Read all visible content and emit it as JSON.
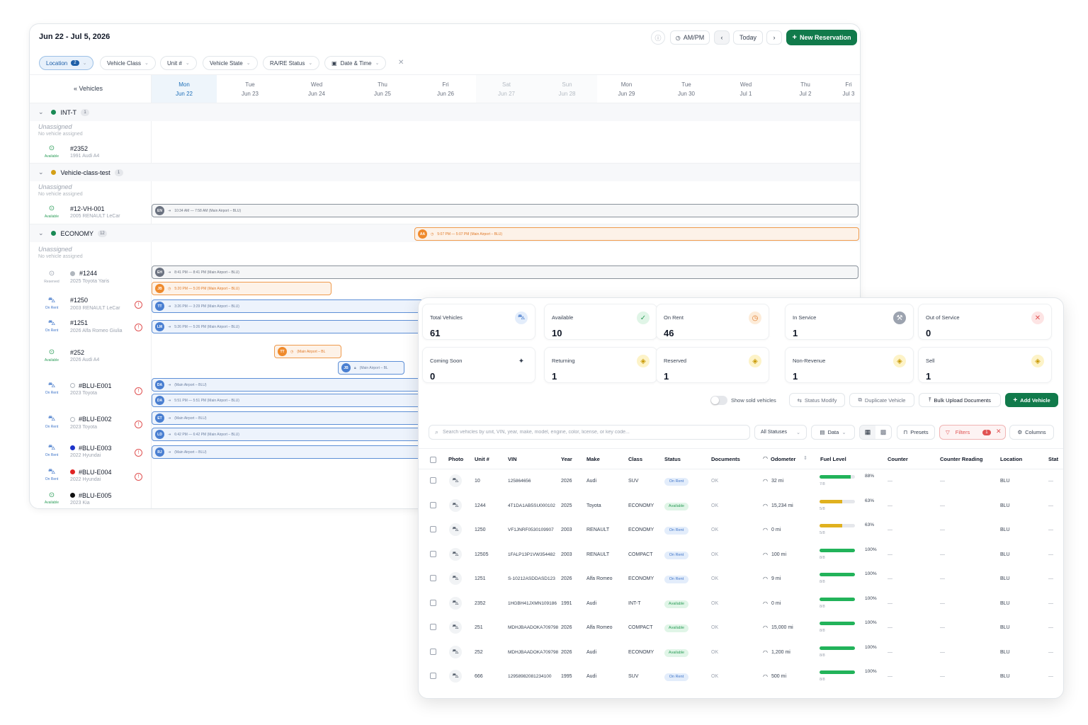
{
  "calendar": {
    "date_range": "Jun 22 - Jul 5, 2026",
    "ampm_label": "AM/PM",
    "today_label": "Today",
    "new_reservation_label": "New Reservation",
    "filters": {
      "location": "Location",
      "location_count": "2",
      "vehicle_class": "Vehicle Class",
      "unit": "Unit #",
      "vehicle_state": "Vehicle State",
      "rare_status": "RA/RE Status",
      "date_time": "Date & Time"
    },
    "vehicles_label": "Vehicles",
    "days": [
      {
        "dow": "Mon",
        "date": "Jun 22"
      },
      {
        "dow": "Tue",
        "date": "Jun 23"
      },
      {
        "dow": "Wed",
        "date": "Jun 24"
      },
      {
        "dow": "Thu",
        "date": "Jun 25"
      },
      {
        "dow": "Fri",
        "date": "Jun 26"
      },
      {
        "dow": "Sat",
        "date": "Jun 27"
      },
      {
        "dow": "Sun",
        "date": "Jun 28"
      },
      {
        "dow": "Mon",
        "date": "Jun 29"
      },
      {
        "dow": "Tue",
        "date": "Jun 30"
      },
      {
        "dow": "Wed",
        "date": "Jul 1"
      },
      {
        "dow": "Thu",
        "date": "Jul 2"
      },
      {
        "dow": "Fri",
        "date": "Jul 3"
      }
    ],
    "groups": [
      {
        "name": "INT-T",
        "count": "1",
        "color": "#1a8a55"
      },
      {
        "name": "Vehicle-class-test",
        "count": "1",
        "color": "#d4a017"
      },
      {
        "name": "ECONOMY",
        "count": "12",
        "color": "#1a8a55"
      }
    ],
    "unassigned": "Unassigned",
    "no_vehicle": "No vehicle assigned",
    "vehicles": [
      {
        "unit": "#2352",
        "sub": "1991 Audi A4",
        "status": "Available"
      },
      {
        "unit": "#12-VH-001",
        "sub": "2005 RENAULT LeCar",
        "status": "Available"
      },
      {
        "unit": "#1244",
        "sub": "2025 Toyota Yaris",
        "status": "Reserved"
      },
      {
        "unit": "#1250",
        "sub": "2003 RENAULT LeCar",
        "status": "On Rent"
      },
      {
        "unit": "#1251",
        "sub": "2026 Alfa Romeo Giulia",
        "status": "On Rent"
      },
      {
        "unit": "#252",
        "sub": "2026 Audi A4",
        "status": "Available"
      },
      {
        "unit": "#BLU-E001",
        "sub": "2023 Toyota",
        "status": "On Rent"
      },
      {
        "unit": "#BLU-E002",
        "sub": "2023 Toyota",
        "status": "On Rent"
      },
      {
        "unit": "#BLU-E003",
        "sub": "2022 Hyundai",
        "status": "On Rent"
      },
      {
        "unit": "#BLU-E004",
        "sub": "2022 Hyundai",
        "status": "On Rent"
      },
      {
        "unit": "#BLU-E005",
        "sub": "2023 Kia",
        "status": "Available"
      }
    ],
    "reservations": [
      {
        "initials": "EN",
        "text": "10:34 AM — 7:58 AM  (Main Airport – BLU)"
      },
      {
        "initials": "AA",
        "text": "5:07 PM — 5:07 PM  (Main Airport – BLU)"
      },
      {
        "initials": "EH",
        "text": "8:41 PM — 8:41 PM  (Main Airport – BLU)"
      },
      {
        "initials": "JB",
        "text": "5:20 PM — 5:20 PM  (Main Airport – BLU)"
      },
      {
        "initials": "TT",
        "text": "3:26 PM — 3:29 PM  (Main Airport – BLU)"
      },
      {
        "initials": "LM",
        "text": "5:26 PM — 5:26 PM  (Main Airport – BLU)"
      },
      {
        "initials": "TT",
        "text": "(Main Airport – BL"
      },
      {
        "initials": "JB",
        "text": "(Main Airport – BL"
      },
      {
        "initials": "DA",
        "text": "(Main Airport – BLU)"
      },
      {
        "initials": "DA",
        "text": "5:51 PM — 5:51 PM  (Main Airport – BLU)"
      },
      {
        "initials": "ET",
        "text": "(Main Airport – BLU)"
      },
      {
        "initials": "LD",
        "text": "6:42 PM — 6:42 PM  (Main Airport – BLU)"
      },
      {
        "initials": "RJ",
        "text": "(Main Airport – BLU)"
      }
    ]
  },
  "fleet": {
    "cards": [
      {
        "label": "Total Vehicles",
        "value": "61",
        "icon": "car-icon",
        "color": "#3f75c9",
        "bg": "#e3edfb"
      },
      {
        "label": "Available",
        "value": "10",
        "icon": "check-circle-icon",
        "color": "#2f9e5b",
        "bg": "#e0f5e7"
      },
      {
        "label": "On Rent",
        "value": "46",
        "icon": "clock-icon",
        "color": "#e07b2a",
        "bg": "#fdecd9"
      },
      {
        "label": "In Service",
        "value": "1",
        "icon": "wrench-icon",
        "color": "#ffffff",
        "bg": "#9ca3af"
      },
      {
        "label": "Out of Service",
        "value": "0",
        "icon": "x-circle-icon",
        "color": "#e05252",
        "bg": "#fde4e4"
      },
      {
        "label": "Coming Soon",
        "value": "0",
        "icon": "sparkle-icon",
        "color": "#374151",
        "bg": "#ffffff"
      },
      {
        "label": "Returning",
        "value": "1",
        "icon": "tag-icon",
        "color": "#c99a06",
        "bg": "#fdf3c8"
      },
      {
        "label": "Reserved",
        "value": "1",
        "icon": "tag-icon",
        "color": "#c99a06",
        "bg": "#fdf3c8"
      },
      {
        "label": "Non-Revenue",
        "value": "1",
        "icon": "tag-icon",
        "color": "#c99a06",
        "bg": "#fdf3c8"
      },
      {
        "label": "Sell",
        "value": "1",
        "icon": "tag-icon",
        "color": "#c99a06",
        "bg": "#fdf3c8"
      }
    ],
    "show_sold": "Show sold vehicles",
    "status_modify": "Status Modify",
    "duplicate_vehicle": "Duplicate Vehicle",
    "bulk_upload": "Bulk Upload Documents",
    "add_vehicle": "Add Vehicle",
    "search_placeholder": "Search vehicles by unit, VIN, year, make, model, engine, color, license, or key code...",
    "all_statuses": "All Statuses",
    "data_label": "Data",
    "presets": "Presets",
    "filters": "Filters",
    "filters_count": "1",
    "columns_label": "Columns",
    "headers": [
      "Photo",
      "Unit #",
      "VIN",
      "Year",
      "Make",
      "Class",
      "Status",
      "Documents",
      "Odometer",
      "Fuel Level",
      "Counter",
      "Counter Reading",
      "Location",
      "Stat"
    ],
    "rows": [
      {
        "unit": "10",
        "vin": "125864656",
        "year": "2026",
        "make": "Audi",
        "class": "SUV",
        "status": "On Rent",
        "docs": "OK",
        "odo": "32 mi",
        "fuel_pct": "88%",
        "fuel_frac": "7/8",
        "fuel": 0.88,
        "counter": "—",
        "reading": "—",
        "location": "BLU",
        "stat": "—"
      },
      {
        "unit": "1244",
        "vin": "4T1DA1AB5SU000102",
        "year": "2025",
        "make": "Toyota",
        "class": "ECONOMY",
        "status": "Available",
        "docs": "OK",
        "odo": "15,234 mi",
        "fuel_pct": "63%",
        "fuel_frac": "5/8",
        "fuel": 0.63,
        "counter": "—",
        "reading": "—",
        "location": "BLU",
        "stat": "—"
      },
      {
        "unit": "1250",
        "vin": "VF1JNRF0530109907",
        "year": "2003",
        "make": "RENAULT",
        "class": "ECONOMY",
        "status": "On Rent",
        "docs": "OK",
        "odo": "0 mi",
        "fuel_pct": "63%",
        "fuel_frac": "5/8",
        "fuel": 0.63,
        "counter": "—",
        "reading": "—",
        "location": "BLU",
        "stat": "—"
      },
      {
        "unit": "12505",
        "vin": "1FALP13P1VW354482",
        "year": "2003",
        "make": "RENAULT",
        "class": "COMPACT",
        "status": "On Rent",
        "docs": "OK",
        "odo": "100 mi",
        "fuel_pct": "100%",
        "fuel_frac": "8/8",
        "fuel": 1.0,
        "counter": "—",
        "reading": "—",
        "location": "BLU",
        "stat": "—"
      },
      {
        "unit": "1251",
        "vin": "S-10212ASDDASD123",
        "year": "2026",
        "make": "Alfa Romeo",
        "class": "ECONOMY",
        "status": "On Rent",
        "docs": "OK",
        "odo": "9 mi",
        "fuel_pct": "100%",
        "fuel_frac": "8/8",
        "fuel": 1.0,
        "counter": "—",
        "reading": "—",
        "location": "BLU",
        "stat": "—"
      },
      {
        "unit": "2352",
        "vin": "1HGBH41JXMN109186",
        "year": "1991",
        "make": "Audi",
        "class": "INT-T",
        "status": "Available",
        "docs": "OK",
        "odo": "0 mi",
        "fuel_pct": "100%",
        "fuel_frac": "8/8",
        "fuel": 1.0,
        "counter": "—",
        "reading": "—",
        "location": "BLU",
        "stat": "—"
      },
      {
        "unit": "251",
        "vin": "MDHJBAADOKA709798",
        "year": "2026",
        "make": "Alfa Romeo",
        "class": "COMPACT",
        "status": "Available",
        "docs": "OK",
        "odo": "15,000 mi",
        "fuel_pct": "100%",
        "fuel_frac": "8/8",
        "fuel": 1.0,
        "counter": "—",
        "reading": "—",
        "location": "BLU",
        "stat": "—"
      },
      {
        "unit": "252",
        "vin": "MDHJBAADOKA709798",
        "year": "2026",
        "make": "Audi",
        "class": "ECONOMY",
        "status": "Available",
        "docs": "OK",
        "odo": "1,200 mi",
        "fuel_pct": "100%",
        "fuel_frac": "8/8",
        "fuel": 1.0,
        "counter": "—",
        "reading": "—",
        "location": "BLU",
        "stat": "—"
      },
      {
        "unit": "666",
        "vin": "12958982081234100",
        "year": "1995",
        "make": "Audi",
        "class": "SUV",
        "status": "On Rent",
        "docs": "OK",
        "odo": "500 mi",
        "fuel_pct": "100%",
        "fuel_frac": "8/8",
        "fuel": 1.0,
        "counter": "—",
        "reading": "—",
        "location": "BLU",
        "stat": "—"
      }
    ]
  }
}
